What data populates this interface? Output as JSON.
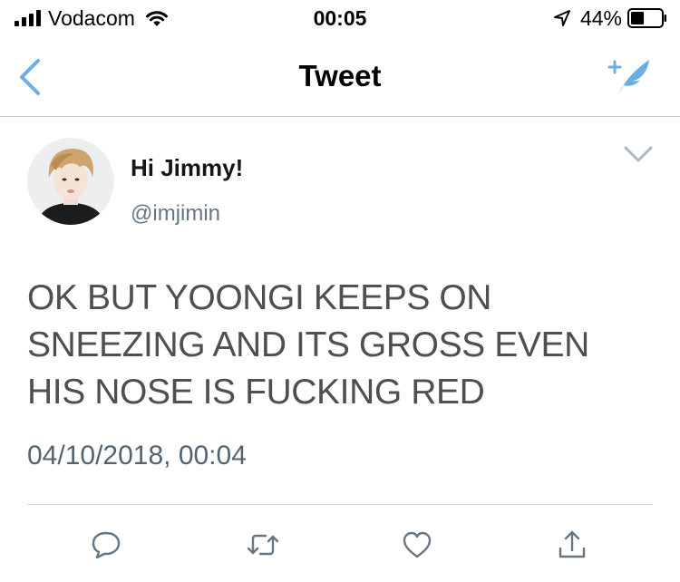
{
  "status_bar": {
    "carrier": "Vodacom",
    "time": "00:05",
    "battery_percent": "44%",
    "battery_level": 0.44,
    "signal_bars": 4,
    "icons": [
      "signal-icon",
      "wifi-icon",
      "location-arrow-icon",
      "battery-icon"
    ]
  },
  "nav": {
    "title": "Tweet",
    "back_icon": "chevron-left-icon",
    "compose_icon": "compose-tweet-icon"
  },
  "tweet": {
    "display_name": "Hi Jimmy!",
    "handle": "@imjimin",
    "text": "OK BUT YOONGI KEEPS ON SNEEZING AND ITS GROSS EVEN HIS NOSE IS FUCKING RED",
    "timestamp": "04/10/2018, 00:04",
    "menu_icon": "chevron-down-icon"
  },
  "actions": {
    "icons": [
      "reply-icon",
      "retweet-icon",
      "like-icon",
      "share-icon"
    ]
  },
  "colors": {
    "accent": "#6aaee5",
    "text": "#14171a",
    "secondary_text": "#657786",
    "tweet_text": "#4d4f52",
    "icon_gray": "#667684",
    "separator": "#c8c8cc"
  }
}
